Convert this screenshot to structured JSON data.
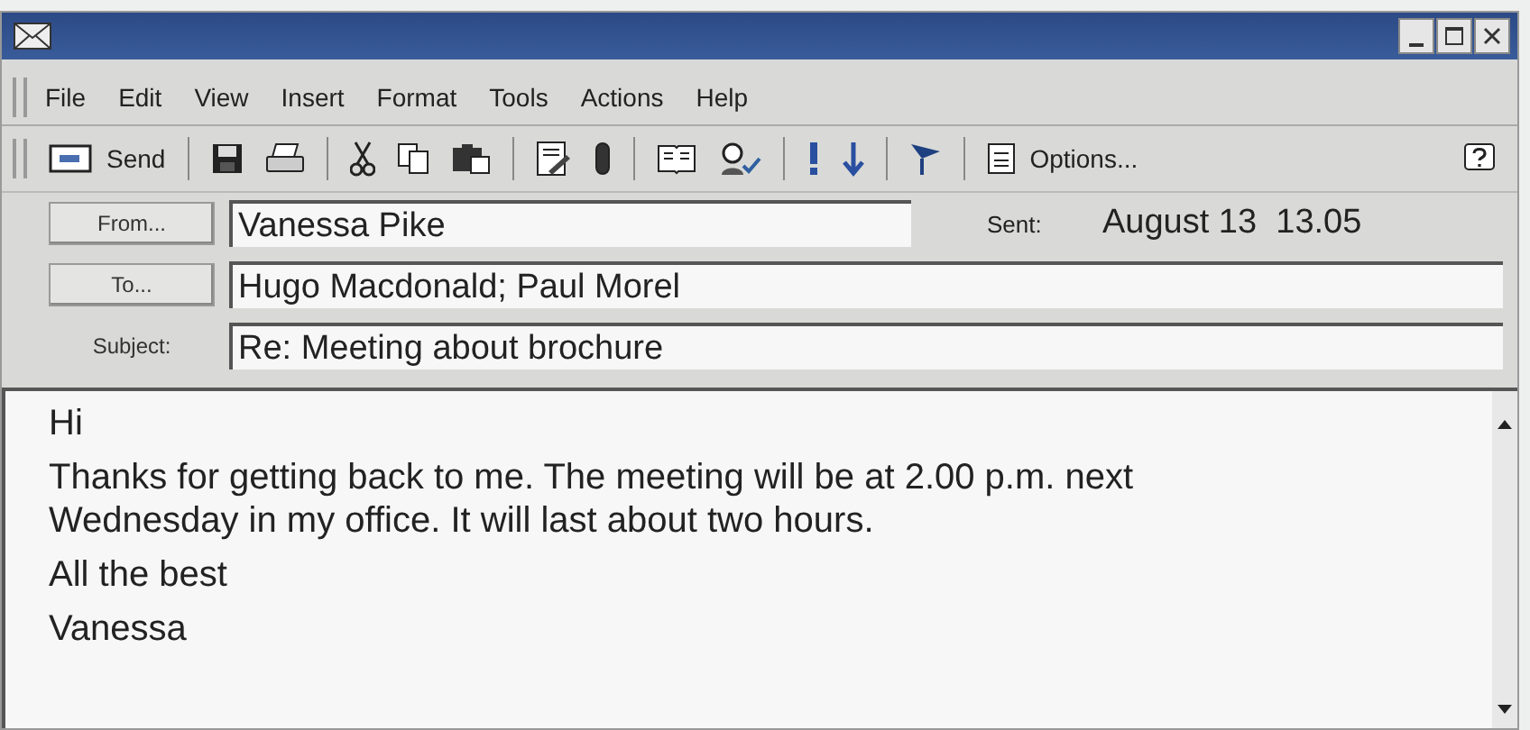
{
  "menu": [
    "File",
    "Edit",
    "View",
    "Insert",
    "Format",
    "Tools",
    "Actions",
    "Help"
  ],
  "toolbar": {
    "send_label": "Send",
    "options_label": "Options..."
  },
  "header": {
    "from_button": "From...",
    "from": "Vanessa Pike",
    "sent_label": "Sent:",
    "sent": "August 13  13.05",
    "to_button": "To...",
    "to": "Hugo Macdonald; Paul Morel",
    "subject_label": "Subject:",
    "subject": "Re: Meeting about brochure"
  },
  "body": [
    "Hi",
    "Thanks for getting back to me. The meeting will be at 2.00 p.m. next Wednesday in my office. It will last about two hours.",
    "All the best",
    "Vanessa"
  ]
}
